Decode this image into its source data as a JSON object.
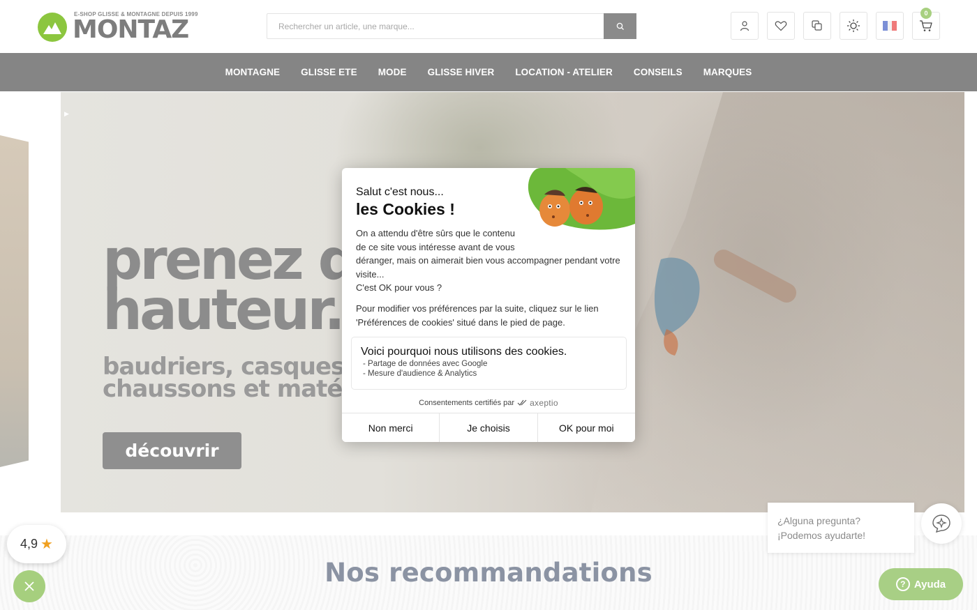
{
  "header": {
    "logo_tagline": "E-SHOP GLISSE & MONTAGNE DEPUIS 1999",
    "logo_text": "MONTAZ",
    "search_placeholder": "Rechercher un article, une marque...",
    "cart_count": "0",
    "icons": [
      "user-icon",
      "heart-icon",
      "compare-icon",
      "theme-sun-icon",
      "french-flag-icon",
      "cart-icon"
    ]
  },
  "nav": {
    "items": [
      "MONTAGNE",
      "GLISSE ETE",
      "MODE",
      "GLISSE HIVER",
      "LOCATION - ATELIER",
      "CONSEILS",
      "MARQUES"
    ]
  },
  "hero": {
    "play_glyph": "▶",
    "title_line1": "prenez de",
    "title_line2": "hauteur.",
    "subtitle_line1": "baudriers, casques,",
    "subtitle_line2": "chaussons et matériel",
    "button": "découvrir"
  },
  "section": {
    "title": "Nos recommandations"
  },
  "rating": {
    "value": "4,9",
    "star": "★"
  },
  "chat": {
    "line1": "¿Alguna pregunta?",
    "line2": "¡Podemos ayudarte!",
    "help_button": "Ayuda",
    "help_glyph": "?"
  },
  "cookie_modal": {
    "greeting": "Salut c'est nous...",
    "title": "les Cookies !",
    "body_line1": "On a attendu d'être sûrs que le contenu de ce site vous intéresse avant de vous",
    "body_line2": "déranger, mais on aimerait bien vous accompagner pendant votre visite...",
    "body_line3": "C'est OK pour vous ?",
    "preferences_text": "Pour modifier vos préférences par la suite, cliquez sur le lien 'Préférences de cookies' situé dans le pied de page.",
    "why_title": "Voici pourquoi nous utilisons des cookies.",
    "why_items": [
      "- Partage de données avec Google",
      "- Mesure d'audience & Analytics"
    ],
    "certified_text": "Consentements certifiés par",
    "certified_brand": "axeptio",
    "buttons": {
      "refuse": "Non merci",
      "choose": "Je choisis",
      "accept": "OK pour moi"
    }
  },
  "colors": {
    "nav_bg": "#858585",
    "brand_green": "#8cc63f",
    "help_green": "#a8cf85",
    "section_title": "#8b93a3"
  }
}
